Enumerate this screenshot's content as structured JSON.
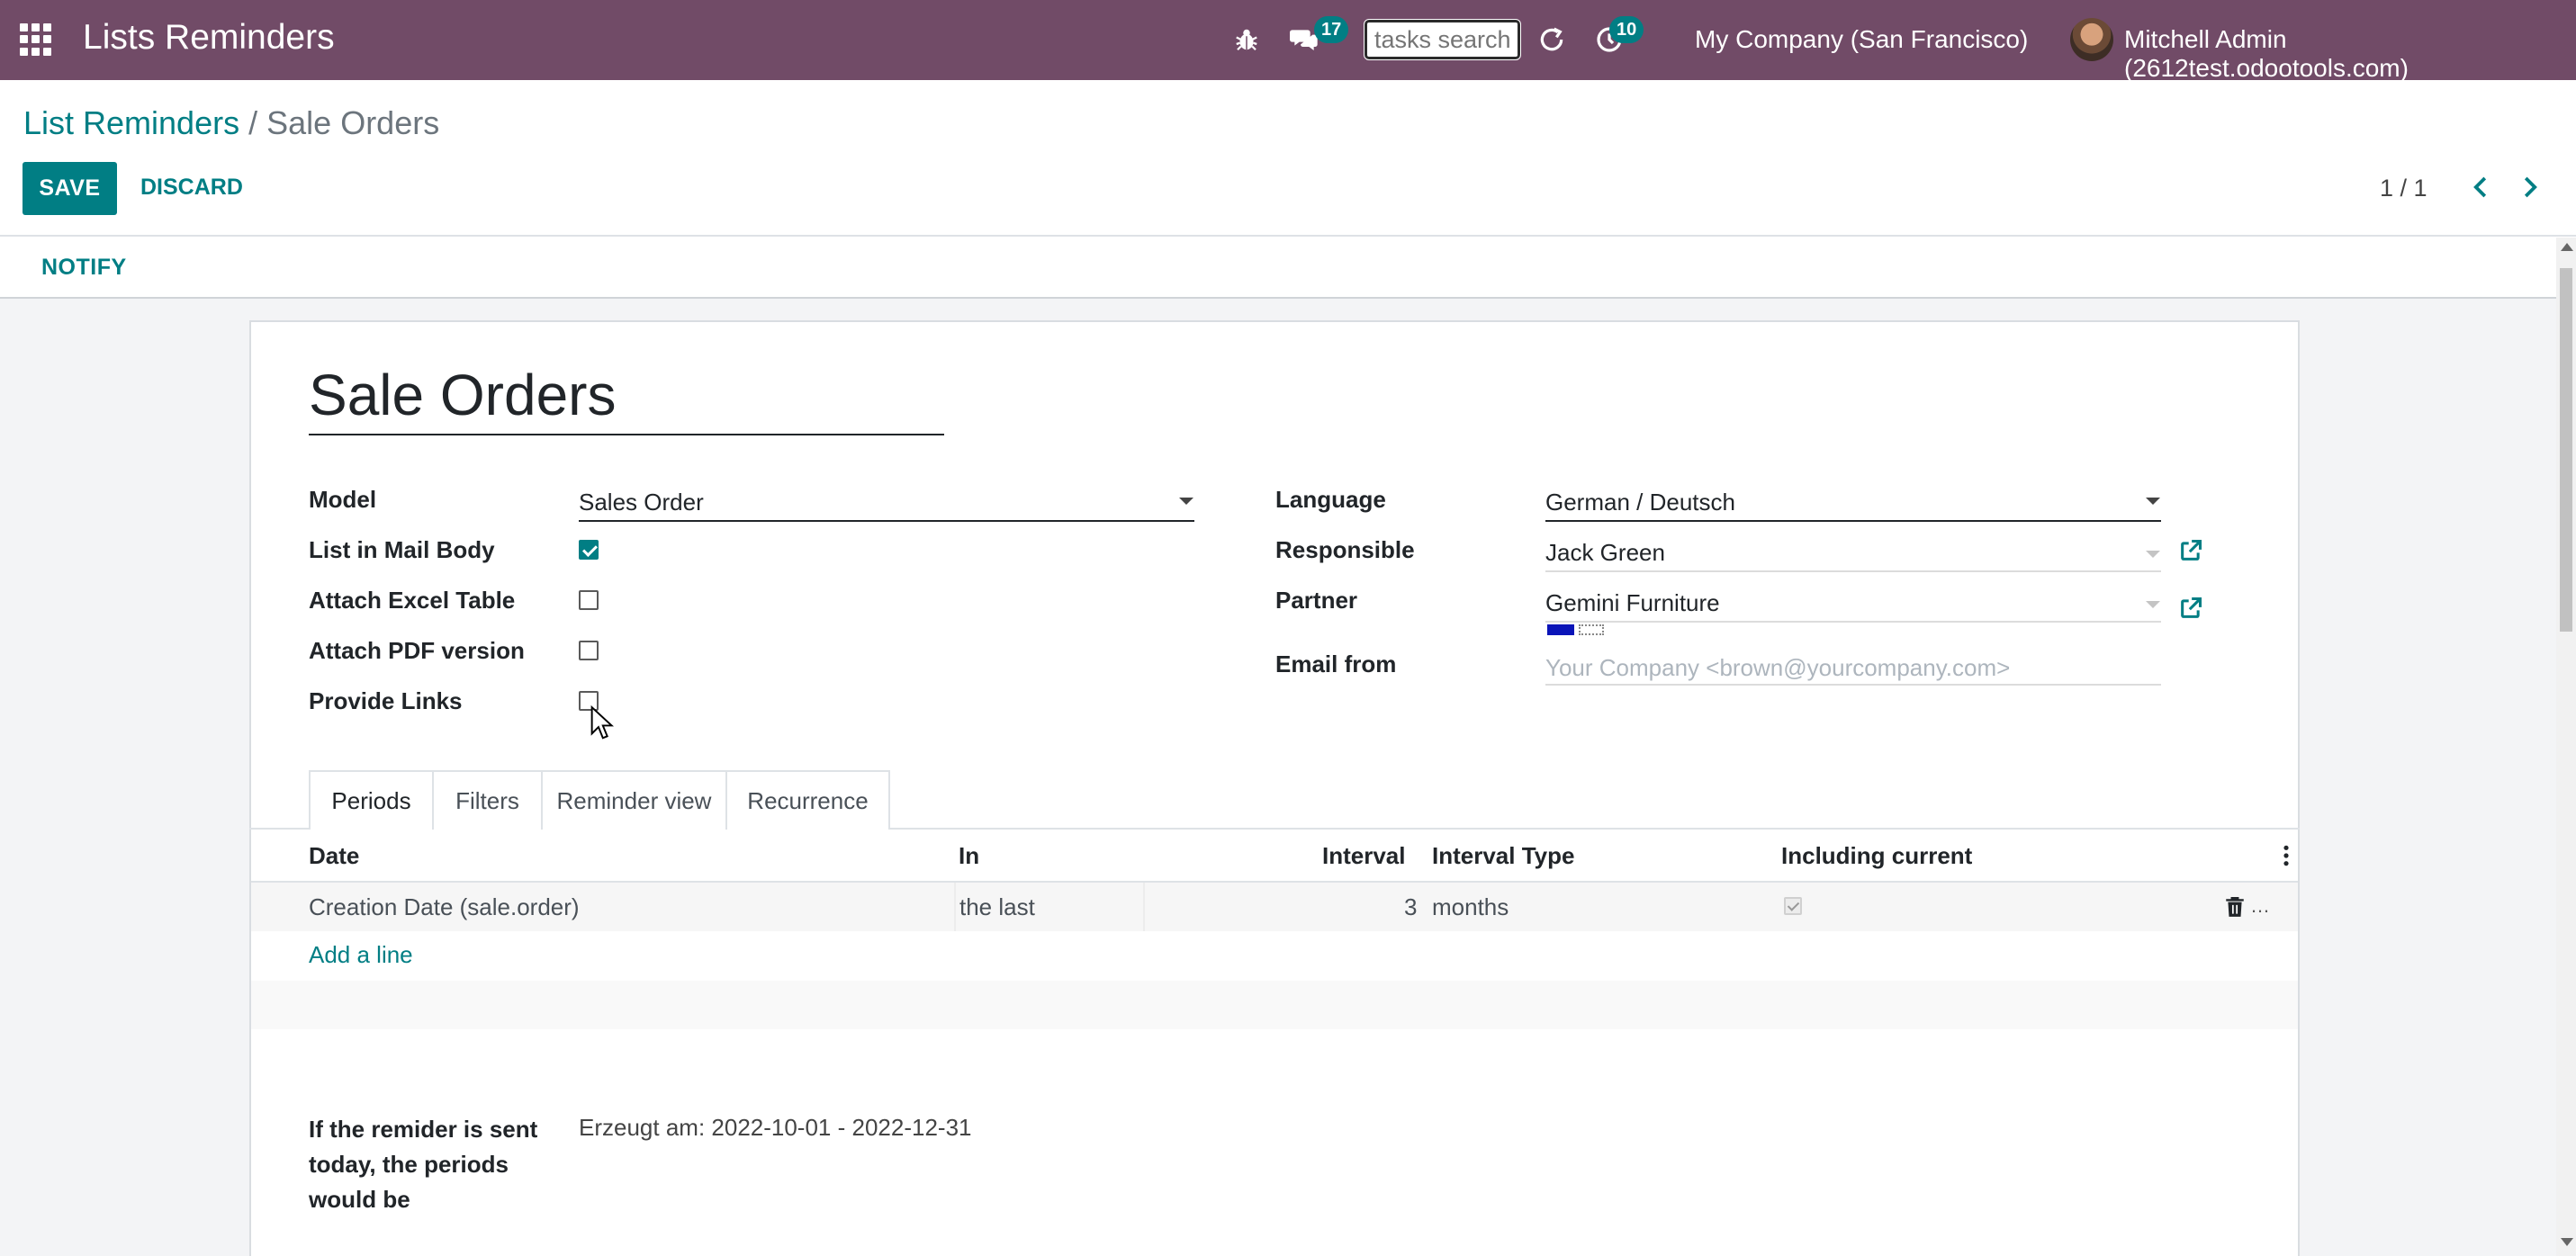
{
  "navbar": {
    "app_title": "Lists Reminders",
    "messages_count": "17",
    "activities_count": "10",
    "search_placeholder": "tasks search",
    "company": "My Company (San Francisco)",
    "user": "Mitchell Admin (2612test.odootools.com)",
    "icons": [
      "apps-icon",
      "bug-icon",
      "chat-icon",
      "refresh-icon",
      "clock-icon"
    ]
  },
  "breadcrumb": {
    "parent": "List Reminders",
    "separator": "/",
    "current": "Sale Orders"
  },
  "toolbar": {
    "save_label": "SAVE",
    "discard_label": "DISCARD",
    "pager": "1 / 1"
  },
  "statusbar": {
    "notify_label": "NOTIFY"
  },
  "form": {
    "title": "Sale Orders",
    "left_fields": {
      "model_label": "Model",
      "model_value": "Sales Order",
      "list_in_mail_body_label": "List in Mail Body",
      "list_in_mail_body_checked": true,
      "attach_excel_label": "Attach Excel Table",
      "attach_excel_checked": false,
      "attach_pdf_label": "Attach PDF version",
      "attach_pdf_checked": false,
      "provide_links_label": "Provide Links",
      "provide_links_checked": false
    },
    "right_fields": {
      "language_label": "Language",
      "language_value": "German / Deutsch",
      "responsible_label": "Responsible",
      "responsible_value": "Jack Green",
      "partner_label": "Partner",
      "partner_value": "Gemini Furniture",
      "email_from_label": "Email from",
      "email_from_placeholder": "Your Company <brown@yourcompany.com>"
    }
  },
  "tabs": [
    {
      "label": "Periods",
      "active": true
    },
    {
      "label": "Filters",
      "active": false
    },
    {
      "label": "Reminder view",
      "active": false
    },
    {
      "label": "Recurrence",
      "active": false
    }
  ],
  "periods_table": {
    "columns": [
      "Date",
      "In",
      "Interval",
      "Interval Type",
      "Including current"
    ],
    "rows": [
      {
        "date": "Creation Date (sale.order)",
        "in": "the last",
        "interval": "3",
        "interval_type": "months",
        "including_current": true
      }
    ],
    "add_line_label": "Add a line"
  },
  "period_info": {
    "label": "If the remider is sent today, the periods would be",
    "value": "Erzeugt am: 2022-10-01 - 2022-12-31"
  },
  "colors": {
    "navbar": "#714b67",
    "primary": "#017e84",
    "sheet_bg": "#f3f4f6"
  }
}
